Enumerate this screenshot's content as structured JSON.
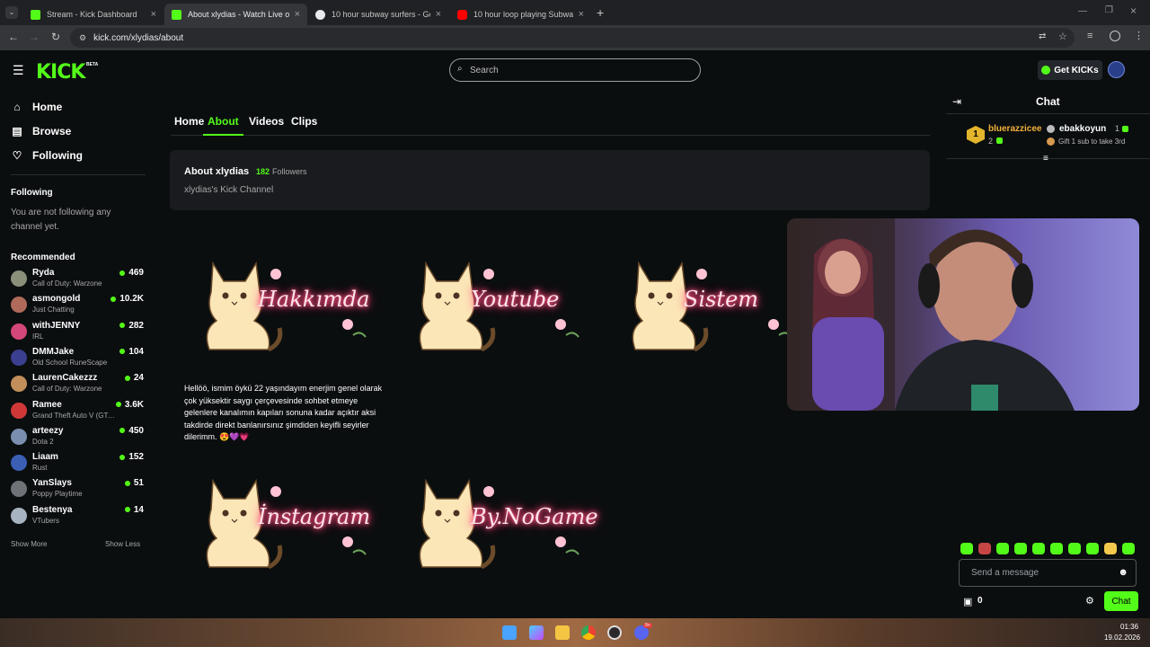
{
  "browser": {
    "tabs": [
      {
        "title": "Stream - Kick Dashboard",
        "favicon_color": "#53fc18",
        "active": false
      },
      {
        "title": "About xlydias - Watch Live on Kick",
        "favicon_color": "#53fc18",
        "active": true
      },
      {
        "title": "10 hour subway surfers - Google",
        "favicon_color": "#4285f4",
        "active": false
      },
      {
        "title": "10 hour loop playing Subway Surfers",
        "favicon_color": "#ff0000",
        "active": false
      }
    ],
    "url": "kick.com/xlydias/about"
  },
  "header": {
    "logo": "KICK",
    "logo_badge": "BETA",
    "search_placeholder": "Search",
    "get_kicks_label": "Get KICKs"
  },
  "sidebar": {
    "nav": [
      {
        "label": "Home",
        "icon": "home-icon"
      },
      {
        "label": "Browse",
        "icon": "browse-icon"
      },
      {
        "label": "Following",
        "icon": "heart-icon"
      }
    ],
    "following_title": "Following",
    "following_empty": "You are not following any channel yet.",
    "recommended_title": "Recommended",
    "recommended": [
      {
        "name": "Ryda",
        "category": "Call of Duty: Warzone",
        "viewers": "469",
        "avatar_color": "#8a8f7a"
      },
      {
        "name": "asmongold",
        "category": "Just Chatting",
        "viewers": "10.2K",
        "avatar_color": "#b06a5a"
      },
      {
        "name": "withJENNY",
        "category": "IRL",
        "viewers": "282",
        "avatar_color": "#d4477a"
      },
      {
        "name": "DMMJake",
        "category": "Old School RuneScape",
        "viewers": "104",
        "avatar_color": "#3a3f8f"
      },
      {
        "name": "LaurenCakezzz",
        "category": "Call of Duty: Warzone",
        "viewers": "24",
        "avatar_color": "#c28f5a"
      },
      {
        "name": "Ramee",
        "category": "Grand Theft Auto V (GTA V)",
        "viewers": "3.6K",
        "avatar_color": "#d03838"
      },
      {
        "name": "arteezy",
        "category": "Dota 2",
        "viewers": "450",
        "avatar_color": "#7a8fb0"
      },
      {
        "name": "Liaam",
        "category": "Rust",
        "viewers": "152",
        "avatar_color": "#3b5fb4"
      },
      {
        "name": "YanSlays",
        "category": "Poppy Playtime",
        "viewers": "51",
        "avatar_color": "#6f7377"
      },
      {
        "name": "Bestenya",
        "category": "VTubers",
        "viewers": "14",
        "avatar_color": "#a7b3c0"
      }
    ],
    "show_more": "Show More",
    "show_less": "Show Less"
  },
  "profile": {
    "tabs": [
      "Home",
      "About",
      "Videos",
      "Clips"
    ],
    "active_tab": "About",
    "about_title": "About xlydias",
    "followers_count": "182",
    "followers_label": "Followers",
    "channel_desc": "xlydias's Kick Channel",
    "panels": [
      "Hakkımda",
      "Youtube",
      "Sistem",
      "İnstagram",
      "By.NoGame"
    ],
    "bio": "Hellöö, ismim öykü 22 yaşındayım enerjim genel olarak çok yüksektir saygı çerçevesinde sohbet etmeye gelenlere kanalımın kapıları sonuna kadar açıktır aksi takdirde direkt banlanırsınız şimdiden keyifli seyirler dilerimm. 😍💜💗"
  },
  "chat": {
    "title": "Chat",
    "leader_rank": "1",
    "leader_name": "bluerazzicee",
    "leader_count": "2",
    "gifter_name": "ebakkoyun",
    "gifter_count": "1",
    "gifter_note": "Gift 1 sub to take 3rd",
    "message_placeholder": "Send a message",
    "kicks_count": "0",
    "send_label": "Chat"
  },
  "taskbar": {
    "time": "01:36",
    "date": "19.02.2026",
    "badge": "9+"
  },
  "colors": {
    "accent": "#53fc18",
    "bg": "#0b0e0f",
    "card": "#191b1f"
  }
}
